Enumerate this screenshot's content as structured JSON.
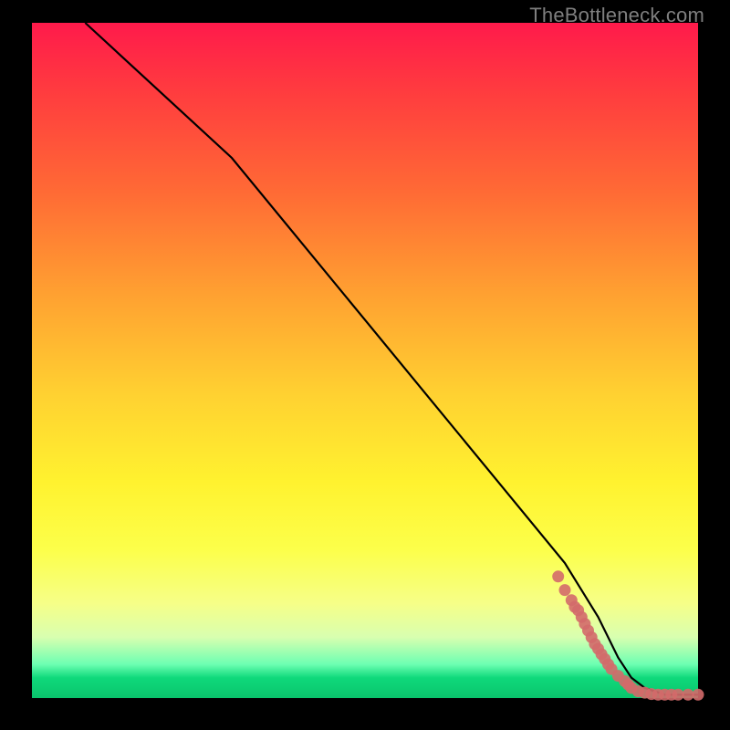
{
  "watermark": "TheBottleneck.com",
  "colors": {
    "frame": "#000000",
    "gradient_top": "#ff1a4b",
    "gradient_mid": "#fff22f",
    "gradient_low": "#0ac46c",
    "line": "#000000",
    "marker": "#d36a6a"
  },
  "chart_data": {
    "type": "line",
    "title": "",
    "xlabel": "",
    "ylabel": "",
    "xlim": [
      0,
      100
    ],
    "ylim": [
      0,
      100
    ],
    "series": [
      {
        "name": "curve",
        "x": [
          8,
          30,
          40,
          50,
          60,
          70,
          80,
          85,
          88,
          90,
          92,
          95,
          100
        ],
        "y": [
          100,
          80,
          68,
          56,
          44,
          32,
          20,
          12,
          6,
          3,
          1.5,
          0.5,
          0.5
        ]
      }
    ],
    "markers": {
      "name": "cluster",
      "points": [
        {
          "x": 79,
          "y": 18
        },
        {
          "x": 80,
          "y": 16
        },
        {
          "x": 81,
          "y": 14.5
        },
        {
          "x": 81.5,
          "y": 13.5
        },
        {
          "x": 82,
          "y": 13
        },
        {
          "x": 82.5,
          "y": 12
        },
        {
          "x": 83,
          "y": 11
        },
        {
          "x": 83.5,
          "y": 10
        },
        {
          "x": 84,
          "y": 9
        },
        {
          "x": 84.5,
          "y": 8
        },
        {
          "x": 85,
          "y": 7.3
        },
        {
          "x": 85.5,
          "y": 6.5
        },
        {
          "x": 86,
          "y": 5.8
        },
        {
          "x": 86.5,
          "y": 5
        },
        {
          "x": 87,
          "y": 4.3
        },
        {
          "x": 88,
          "y": 3.3
        },
        {
          "x": 89,
          "y": 2.5
        },
        {
          "x": 89.5,
          "y": 2
        },
        {
          "x": 90,
          "y": 1.5
        },
        {
          "x": 91,
          "y": 1
        },
        {
          "x": 92,
          "y": 0.8
        },
        {
          "x": 93,
          "y": 0.6
        },
        {
          "x": 94,
          "y": 0.5
        },
        {
          "x": 95,
          "y": 0.5
        },
        {
          "x": 96,
          "y": 0.5
        },
        {
          "x": 97,
          "y": 0.5
        },
        {
          "x": 98.5,
          "y": 0.5
        },
        {
          "x": 100,
          "y": 0.5
        }
      ]
    }
  }
}
